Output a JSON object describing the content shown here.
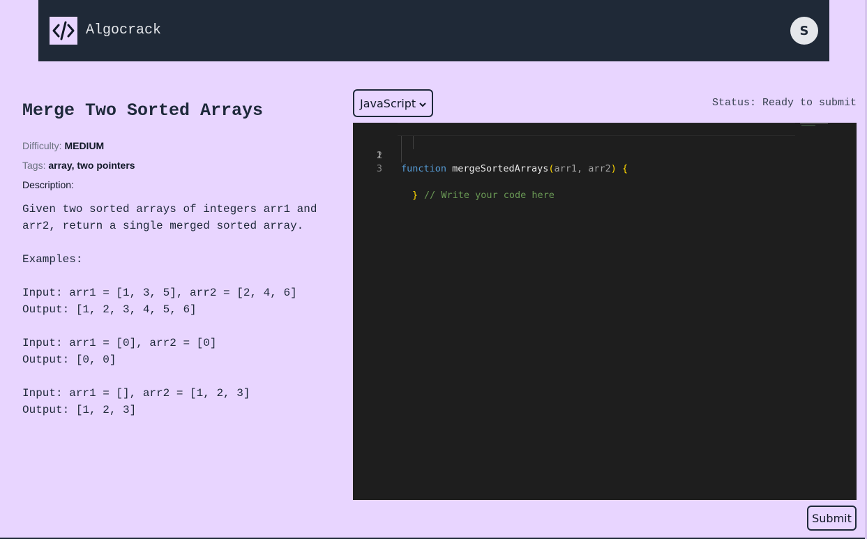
{
  "app": {
    "brand": "Algocrack",
    "user_initial": "S"
  },
  "problem": {
    "title": "Merge Two Sorted Arrays",
    "difficulty_label": "Difficulty:",
    "difficulty": "MEDIUM",
    "tags_label": "Tags:",
    "tags": "array, two pointers",
    "description_label": "Description:",
    "description": "Given two sorted arrays of integers arr1 and\narr2, return a single merged sorted array.\n\nExamples:\n\nInput: arr1 = [1, 3, 5], arr2 = [2, 4, 6]\nOutput: [1, 2, 3, 4, 5, 6]\n\nInput: arr1 = [0], arr2 = [0]\nOutput: [0, 0]\n\nInput: arr1 = [], arr2 = [1, 2, 3]\nOutput: [1, 2, 3]"
  },
  "editor": {
    "language": "JavaScript",
    "status": "Status: Ready to submit",
    "lines": [
      {
        "num": "1",
        "keyword": "function",
        "name": "mergeSortedArrays",
        "open_paren": "(",
        "params": "arr1, arr2",
        "close_paren": ")",
        "brace": "{"
      },
      {
        "num": "2",
        "comment": "// Write your code here"
      },
      {
        "num": "3",
        "brace": "}"
      }
    ],
    "submit_label": "Submit"
  },
  "colors": {
    "background": "#e8d5ff",
    "navbar": "#1f2937",
    "editor_bg": "#1e1e1e"
  }
}
